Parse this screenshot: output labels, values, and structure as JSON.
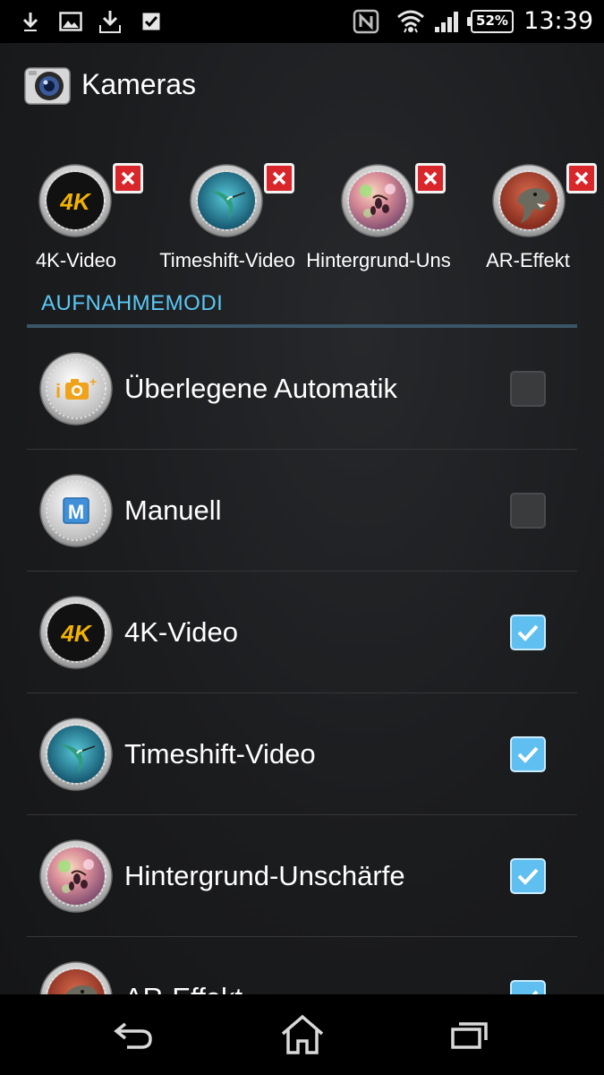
{
  "status_bar": {
    "time": "13:39",
    "battery": "52%",
    "icons": [
      "download-icon",
      "image-icon",
      "download-complete-icon",
      "checkbox-task-icon",
      "nfc-icon",
      "wifi-icon",
      "signal-icon",
      "battery-icon"
    ]
  },
  "action_bar": {
    "title": "Kameras",
    "icon": "camera-app-icon"
  },
  "favorites": [
    {
      "label": "4K-Video",
      "icon": "4k-video-icon"
    },
    {
      "label": "Timeshift-Video",
      "icon": "hummingbird-icon"
    },
    {
      "label": "Hintergrund-Uns",
      "icon": "background-blur-icon"
    },
    {
      "label": "AR-Effekt",
      "icon": "dinosaur-icon"
    }
  ],
  "section": {
    "header": "AUFNAHMEMODI"
  },
  "modes": [
    {
      "label": "Überlegene Automatik",
      "icon": "superior-auto-icon",
      "checked": false
    },
    {
      "label": "Manuell",
      "icon": "manual-m-icon",
      "checked": false
    },
    {
      "label": "4K-Video",
      "icon": "4k-video-icon",
      "checked": true
    },
    {
      "label": "Timeshift-Video",
      "icon": "hummingbird-icon",
      "checked": true
    },
    {
      "label": "Hintergrund-Unschärfe",
      "icon": "background-blur-icon",
      "checked": true
    },
    {
      "label": "AR-Effekt",
      "icon": "dinosaur-icon",
      "checked": true
    }
  ],
  "nav_bar": {
    "icons": [
      "back-icon",
      "home-icon",
      "recents-icon"
    ]
  },
  "colors": {
    "accent": "#5bc8f5",
    "checkbox_checked": "#5fbff0",
    "remove_badge": "#d9262b",
    "background": "#1b1c1e"
  }
}
